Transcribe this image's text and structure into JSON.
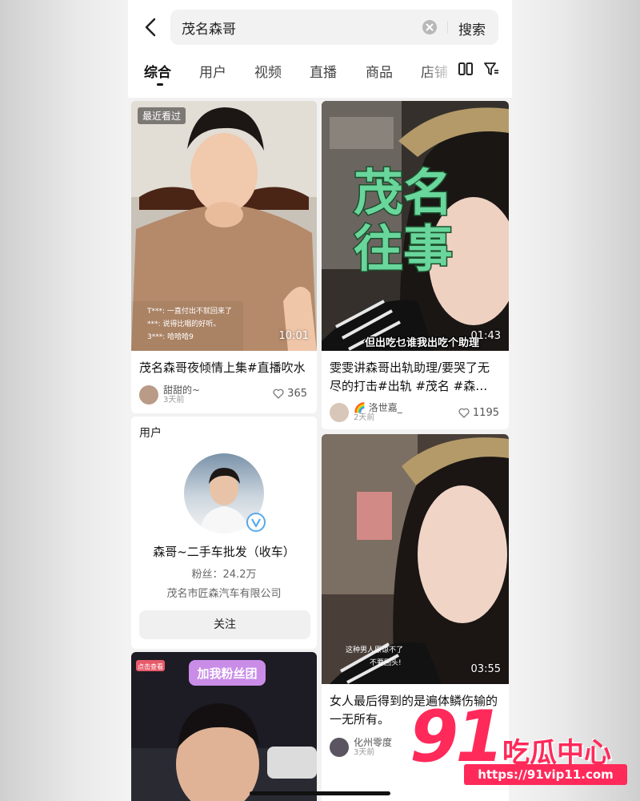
{
  "search": {
    "query": "茂名森哥",
    "button": "搜索"
  },
  "tabs": [
    "综合",
    "用户",
    "视频",
    "直播",
    "商品",
    "店铺"
  ],
  "cards": [
    {
      "badge": "最近看过",
      "duration": "10:01",
      "title": "茂名森哥夜倾情上集#直播吹水",
      "author": "甜甜的~",
      "time": "3天前",
      "likes": "365",
      "comments": [
        "T***: 一直付出不就回来了",
        "***: 说得比唱的好听。",
        "3***: 哈哈哈9"
      ]
    },
    {
      "overlay": [
        "茂名",
        "往事"
      ],
      "subtitle": "但出吃乜谁我出吃个助理",
      "duration": "01:43",
      "title": "雯雯讲森哥出轨助理/要哭了无尽的打击#出轨 #茂名 #森…",
      "author": "🌈 洛世嘉_",
      "time": "2天前",
      "likes": "1195"
    },
    {
      "duration": "03:55",
      "title": "女人最后得到的是遍体鳞伤输的一无所有。",
      "author": "化州零度",
      "time": "3天前",
      "comments": [
        "这种男人原谅不了",
        "不要回头!"
      ]
    },
    {
      "badge": "点击查看",
      "banner": "加我粉丝团"
    }
  ],
  "user_card": {
    "label": "用户",
    "name": "森哥~二手车批发（收车）",
    "fans": "粉丝：24.2万",
    "company": "茂名市匠森汽车有限公司",
    "follow": "关注"
  },
  "watermark": {
    "number": "91",
    "text": "吃瓜中心",
    "url": "https://91vip11.com"
  },
  "colors": {
    "accent": "#ff2a5a",
    "overlay_green": "#69d69b"
  }
}
